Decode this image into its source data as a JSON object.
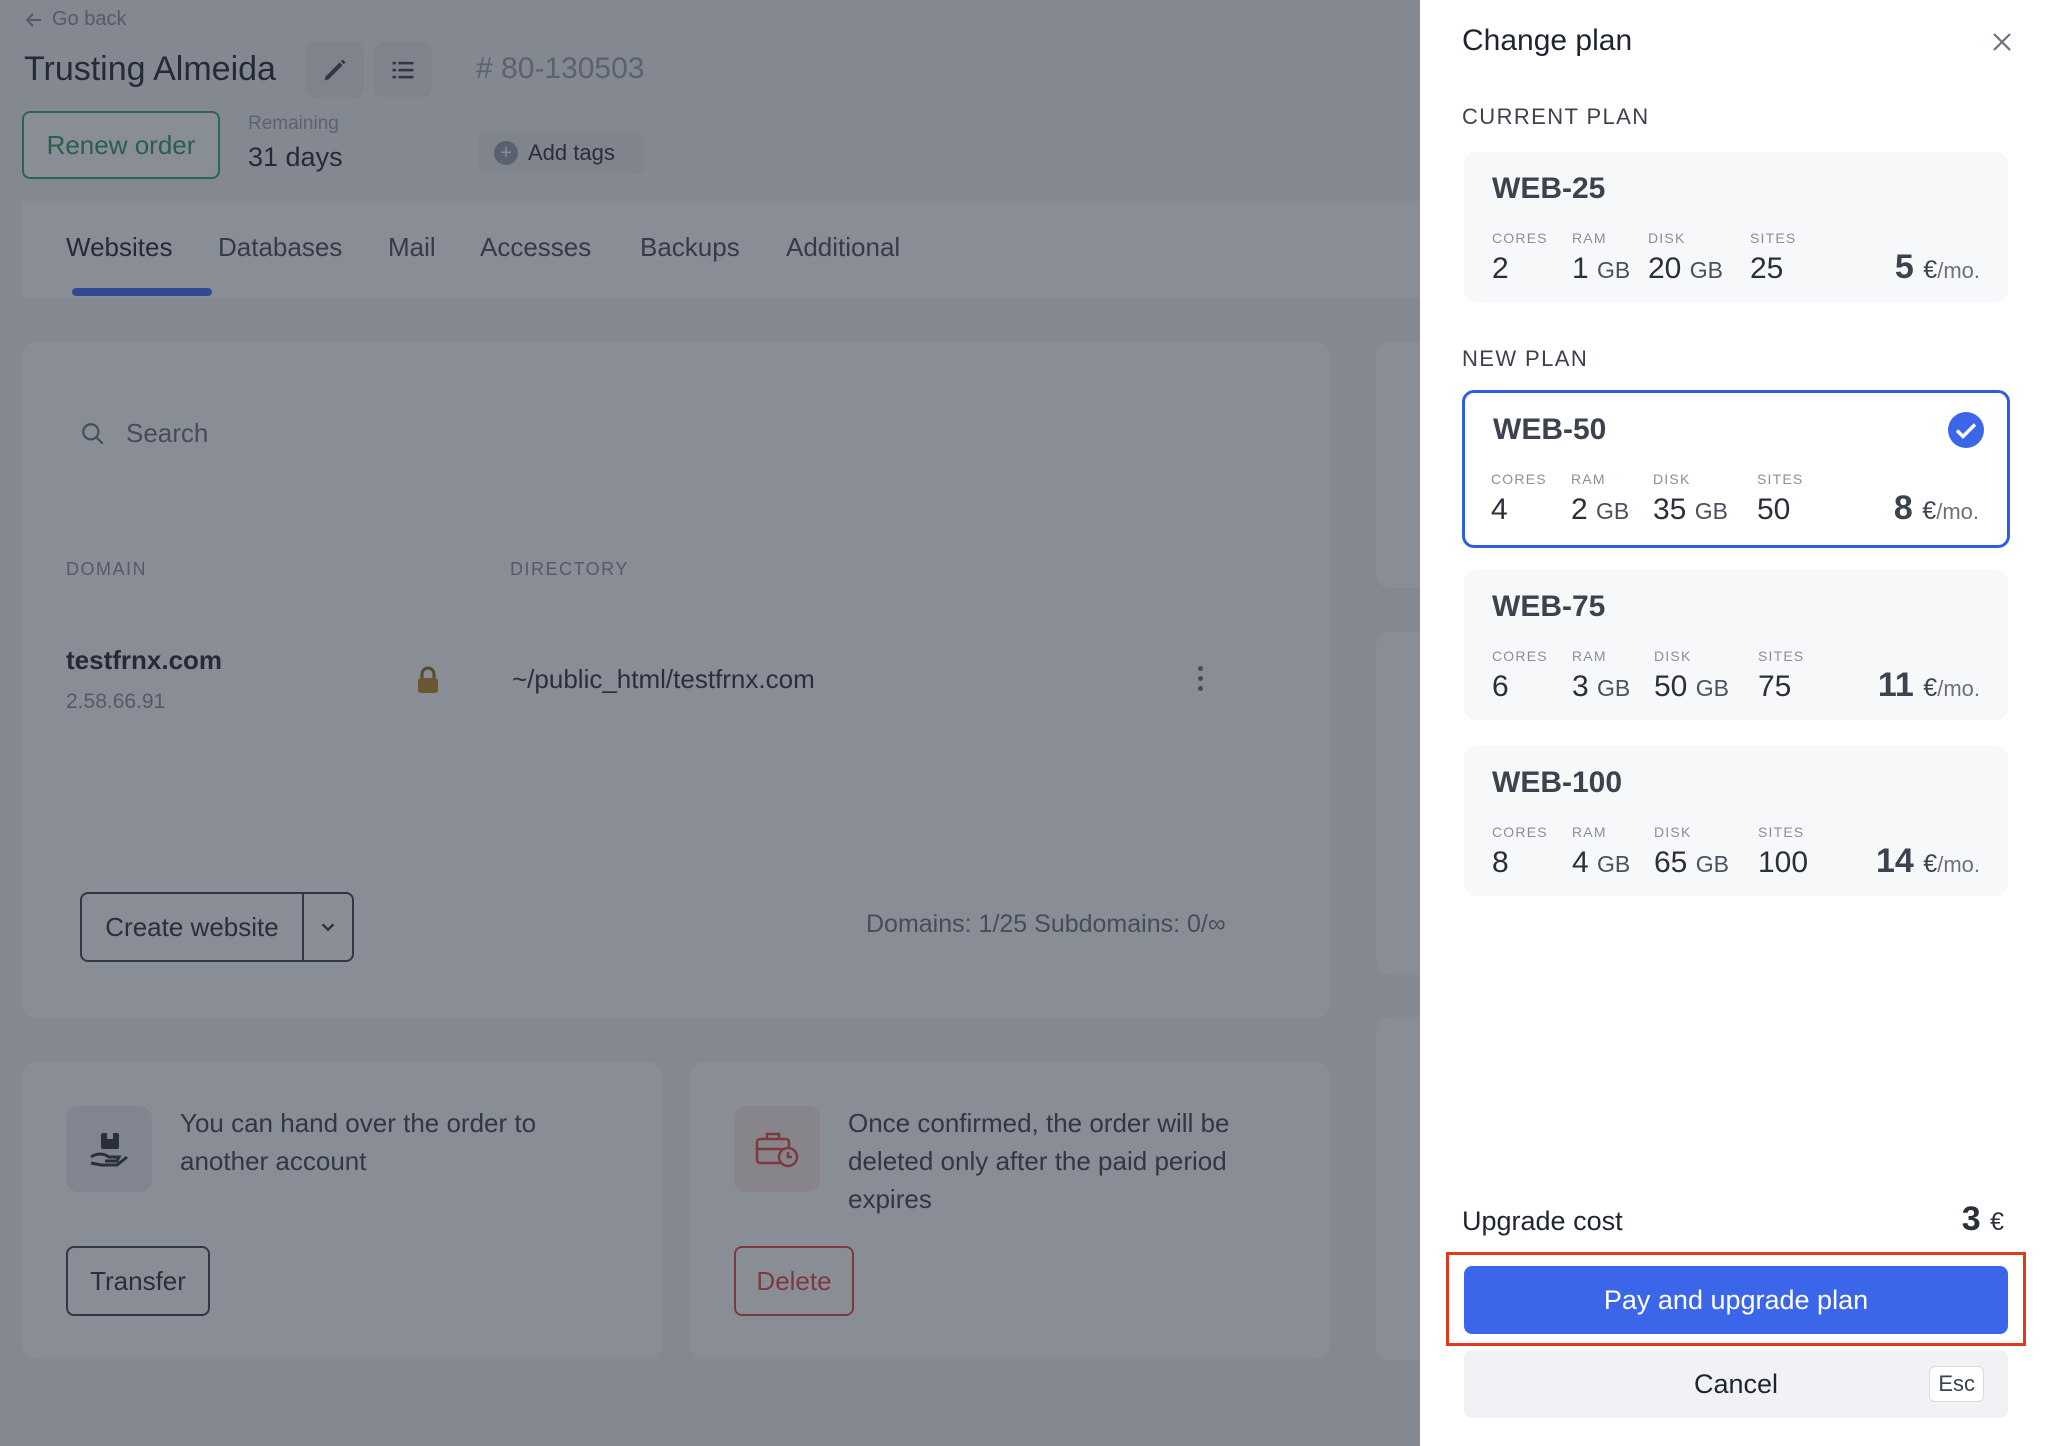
{
  "background": {
    "go_back": "Go back",
    "order_title": "Trusting Almeida",
    "order_id": "# 80-130503",
    "renew_label": "Renew order",
    "remaining_label": "Remaining",
    "remaining_value": "31 days",
    "add_tags_label": "Add tags",
    "tabs": [
      {
        "label": "Websites",
        "active": true
      },
      {
        "label": "Databases"
      },
      {
        "label": "Mail"
      },
      {
        "label": "Accesses"
      },
      {
        "label": "Backups"
      },
      {
        "label": "Additional"
      }
    ],
    "search_placeholder": "Search",
    "columns": {
      "domain": "DOMAIN",
      "directory": "DIRECTORY"
    },
    "website_row": {
      "domain": "testfrnx.com",
      "ip": "2.58.66.91",
      "directory": "~/public_html/testfrnx.com"
    },
    "create_website_label": "Create website",
    "domains_count": "Domains: 1/25   Subdomains: 0/∞",
    "transfer_text": "You can hand over the order to another account",
    "transfer_label": "Transfer",
    "delete_text": "Once confirmed, the order will be deleted only after the paid period expires",
    "delete_label": "Delete"
  },
  "drawer": {
    "title": "Change plan",
    "current_plan_label": "CURRENT PLAN",
    "new_plan_label": "NEW PLAN",
    "spec_labels": {
      "cores": "CORES",
      "ram": "RAM",
      "disk": "DISK",
      "sites": "SITES"
    },
    "unit_gb": "GB",
    "currency": "€",
    "per_month": "/mo.",
    "current_plan": {
      "name": "WEB-25",
      "cores": "2",
      "ram": "1",
      "disk": "20",
      "sites": "25",
      "price": "5"
    },
    "plans": [
      {
        "name": "WEB-50",
        "cores": "4",
        "ram": "2",
        "disk": "35",
        "sites": "50",
        "price": "8",
        "selected": true
      },
      {
        "name": "WEB-75",
        "cores": "6",
        "ram": "3",
        "disk": "50",
        "sites": "75",
        "price": "11"
      },
      {
        "name": "WEB-100",
        "cores": "8",
        "ram": "4",
        "disk": "65",
        "sites": "100",
        "price": "14"
      }
    ],
    "upgrade_cost_label": "Upgrade cost",
    "upgrade_cost_value": "3",
    "pay_label": "Pay and upgrade plan",
    "cancel_label": "Cancel",
    "esc_label": "Esc"
  },
  "colors": {
    "accent": "#3b66ea",
    "selected_border": "#2f5fe0",
    "highlight": "#e0391c",
    "renew_green": "#2e9a5f",
    "delete_red": "#e04a3c"
  },
  "icons": [
    "arrow-left-icon",
    "pencil-icon",
    "list-icon",
    "plus-circle-icon",
    "search-icon",
    "lock-icon",
    "kebab-menu-icon",
    "chevron-down-icon",
    "hand-box-icon",
    "briefcase-clock-icon",
    "close-icon",
    "check-circle-icon"
  ]
}
